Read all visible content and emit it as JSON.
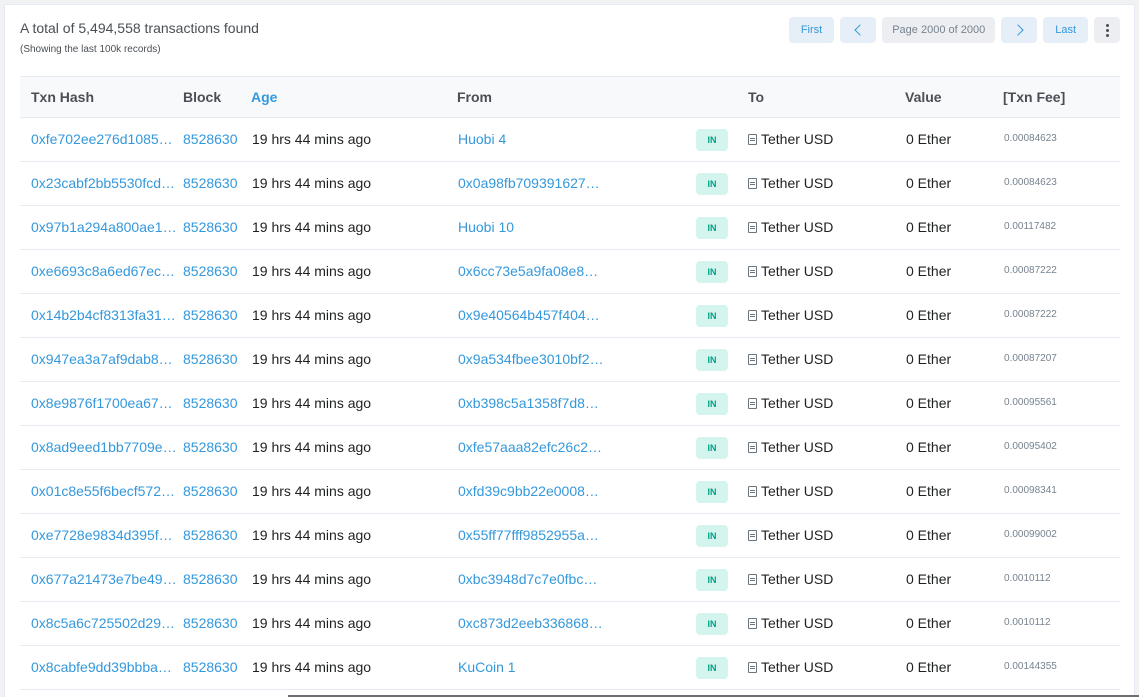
{
  "summary": {
    "total_text": "A total of 5,494,558 transactions found",
    "note_text": "(Showing the last 100k records)"
  },
  "pagination": {
    "first_label": "First",
    "prev_icon": "chevron-left-icon",
    "page_label": "Page 2000 of 2000",
    "next_icon": "chevron-right-icon",
    "last_label": "Last",
    "more_icon": "vertical-dots-icon"
  },
  "table": {
    "headers": {
      "txn_hash": "Txn Hash",
      "block": "Block",
      "age": "Age",
      "from": "From",
      "to": "To",
      "value": "Value",
      "fee": "[Txn Fee]"
    },
    "rows": [
      {
        "hash": "0xfe702ee276d1085…",
        "block": "8528630",
        "age": "19 hrs 44 mins ago",
        "from": "Huobi 4",
        "direction": "IN",
        "to": "Tether USD",
        "value": "0 Ether",
        "fee": "0.00084623"
      },
      {
        "hash": "0x23cabf2bb5530fcd…",
        "block": "8528630",
        "age": "19 hrs 44 mins ago",
        "from": "0x0a98fb709391627…",
        "direction": "IN",
        "to": "Tether USD",
        "value": "0 Ether",
        "fee": "0.00084623"
      },
      {
        "hash": "0x97b1a294a800ae1…",
        "block": "8528630",
        "age": "19 hrs 44 mins ago",
        "from": "Huobi 10",
        "direction": "IN",
        "to": "Tether USD",
        "value": "0 Ether",
        "fee": "0.00117482"
      },
      {
        "hash": "0xe6693c8a6ed67ec…",
        "block": "8528630",
        "age": "19 hrs 44 mins ago",
        "from": "0x6cc73e5a9fa08e8…",
        "direction": "IN",
        "to": "Tether USD",
        "value": "0 Ether",
        "fee": "0.00087222"
      },
      {
        "hash": "0x14b2b4cf8313fa31…",
        "block": "8528630",
        "age": "19 hrs 44 mins ago",
        "from": "0x9e40564b457f404…",
        "direction": "IN",
        "to": "Tether USD",
        "value": "0 Ether",
        "fee": "0.00087222"
      },
      {
        "hash": "0x947ea3a7af9dab8…",
        "block": "8528630",
        "age": "19 hrs 44 mins ago",
        "from": "0x9a534fbee3010bf2…",
        "direction": "IN",
        "to": "Tether USD",
        "value": "0 Ether",
        "fee": "0.00087207"
      },
      {
        "hash": "0x8e9876f1700ea67…",
        "block": "8528630",
        "age": "19 hrs 44 mins ago",
        "from": "0xb398c5a1358f7d8…",
        "direction": "IN",
        "to": "Tether USD",
        "value": "0 Ether",
        "fee": "0.00095561"
      },
      {
        "hash": "0x8ad9eed1bb7709e…",
        "block": "8528630",
        "age": "19 hrs 44 mins ago",
        "from": "0xfe57aaa82efc26c2…",
        "direction": "IN",
        "to": "Tether USD",
        "value": "0 Ether",
        "fee": "0.00095402"
      },
      {
        "hash": "0x01c8e55f6becf572…",
        "block": "8528630",
        "age": "19 hrs 44 mins ago",
        "from": "0xfd39c9bb22e0008…",
        "direction": "IN",
        "to": "Tether USD",
        "value": "0 Ether",
        "fee": "0.00098341"
      },
      {
        "hash": "0xe7728e9834d395f…",
        "block": "8528630",
        "age": "19 hrs 44 mins ago",
        "from": "0x55ff77fff9852955a…",
        "direction": "IN",
        "to": "Tether USD",
        "value": "0 Ether",
        "fee": "0.00099002"
      },
      {
        "hash": "0x677a21473e7be49…",
        "block": "8528630",
        "age": "19 hrs 44 mins ago",
        "from": "0xbc3948d7c7e0fbc…",
        "direction": "IN",
        "to": "Tether USD",
        "value": "0 Ether",
        "fee": "0.0010112"
      },
      {
        "hash": "0x8c5a6c725502d29…",
        "block": "8528630",
        "age": "19 hrs 44 mins ago",
        "from": "0xc873d2eeb336868…",
        "direction": "IN",
        "to": "Tether USD",
        "value": "0 Ether",
        "fee": "0.0010112"
      },
      {
        "hash": "0x8cabfe9dd39bbba…",
        "block": "8528630",
        "age": "19 hrs 44 mins ago",
        "from": "KuCoin 1",
        "direction": "IN",
        "to": "Tether USD",
        "value": "0 Ether",
        "fee": "0.00144355"
      }
    ]
  },
  "colors": {
    "link": "#3498db",
    "badge_in_bg": "#d4f5ee",
    "badge_in_text": "#00a186"
  }
}
